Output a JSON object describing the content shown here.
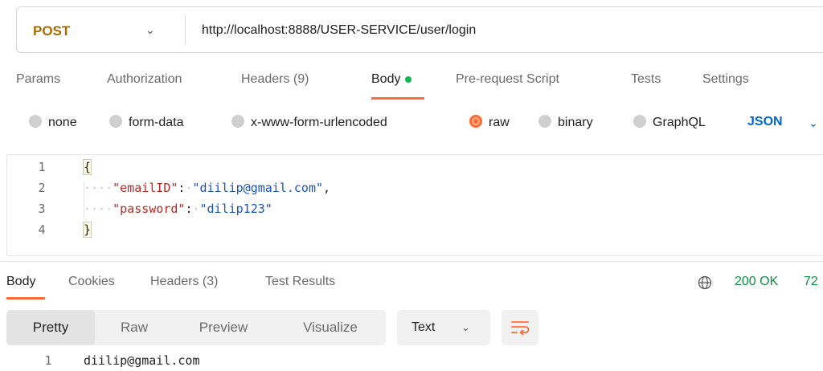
{
  "request": {
    "method": "POST",
    "url": "http://localhost:8888/USER-SERVICE/user/login"
  },
  "request_tabs": [
    {
      "label": "Params"
    },
    {
      "label": "Authorization"
    },
    {
      "label": "Headers (9)"
    },
    {
      "label": "Body"
    },
    {
      "label": "Pre-request Script"
    },
    {
      "label": "Tests"
    },
    {
      "label": "Settings"
    }
  ],
  "active_request_tab": "Body",
  "body_types": [
    {
      "label": "none"
    },
    {
      "label": "form-data"
    },
    {
      "label": "x-www-form-urlencoded"
    },
    {
      "label": "raw"
    },
    {
      "label": "binary"
    },
    {
      "label": "GraphQL"
    }
  ],
  "selected_body_type": "raw",
  "raw_format": "JSON",
  "editor": {
    "line_numbers": [
      "1",
      "2",
      "3",
      "4"
    ],
    "open_brace": "{",
    "close_brace": "}",
    "lines": [
      {
        "key": "\"emailID\"",
        "value": "\"diilip@gmail.com\"",
        "trailing": ","
      },
      {
        "key": "\"password\"",
        "value": "\"dilip123\"",
        "trailing": ""
      }
    ]
  },
  "response_tabs": [
    {
      "label": "Body"
    },
    {
      "label": "Cookies"
    },
    {
      "label": "Headers (3)"
    },
    {
      "label": "Test Results"
    }
  ],
  "active_response_tab": "Body",
  "status": "200 OK",
  "status_extra": "72",
  "view_modes": [
    {
      "label": "Pretty"
    },
    {
      "label": "Raw"
    },
    {
      "label": "Preview"
    },
    {
      "label": "Visualize"
    }
  ],
  "active_view_mode": "Pretty",
  "response_format": "Text",
  "response_body": {
    "line_number": "1",
    "text": "diilip@gmail.com"
  },
  "colors": {
    "accent": "#ff6c37",
    "method": "#a86c00",
    "status_ok": "#0b8f40",
    "json_link": "#0265d2",
    "json_key": "#b42a26",
    "json_string": "#1a54b8",
    "body_dot": "#0cbb52"
  },
  "icons": {
    "method_dropdown": "chevron-down-icon",
    "format_dropdown": "chevron-down-icon",
    "network": "globe-icon",
    "wrap": "wrap-lines-icon"
  }
}
